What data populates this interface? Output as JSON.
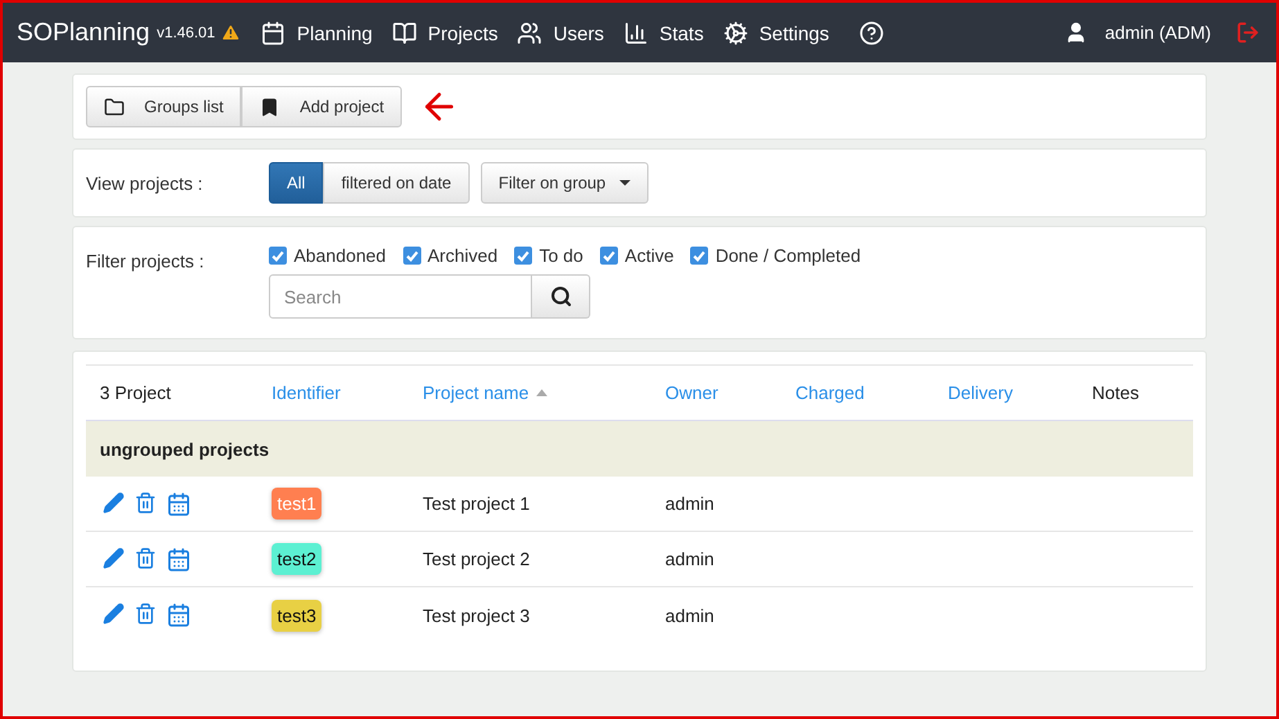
{
  "navbar": {
    "brand": "SOPlanning",
    "version": "v1.46.01",
    "menu": [
      {
        "label": "Planning"
      },
      {
        "label": "Projects"
      },
      {
        "label": "Users"
      },
      {
        "label": "Stats"
      },
      {
        "label": "Settings"
      }
    ],
    "user": "admin (ADM)"
  },
  "toolbar": {
    "buttons": [
      {
        "label": "Groups list"
      },
      {
        "label": "Add project"
      }
    ]
  },
  "view_projects": {
    "label": "View projects :",
    "toggle": [
      {
        "label": "All",
        "selected": true
      },
      {
        "label": "filtered on date",
        "selected": false
      }
    ],
    "dropdown": "Filter on group"
  },
  "filter_projects": {
    "label": "Filter projects :",
    "statuses": [
      {
        "label": "Abandoned",
        "checked": true
      },
      {
        "label": "Archived",
        "checked": true
      },
      {
        "label": "To do",
        "checked": true
      },
      {
        "label": "Active",
        "checked": true
      },
      {
        "label": "Done / Completed",
        "checked": true
      }
    ],
    "search": {
      "placeholder": "Search"
    }
  },
  "table": {
    "columns": [
      {
        "label": "3 Project",
        "link": false,
        "sorted": false
      },
      {
        "label": "Identifier",
        "link": true,
        "sorted": false
      },
      {
        "label": "Project name",
        "link": true,
        "sorted": true
      },
      {
        "label": "Owner",
        "link": true,
        "sorted": false
      },
      {
        "label": "Charged",
        "link": true,
        "sorted": false
      },
      {
        "label": "Delivery",
        "link": true,
        "sorted": false
      },
      {
        "label": "Notes",
        "link": false,
        "sorted": false
      }
    ],
    "group": "ungrouped projects",
    "rows": [
      {
        "identifier": "test1",
        "color": "#ff7f50",
        "name": "Test project 1",
        "owner": "admin"
      },
      {
        "identifier": "test2",
        "color": "#5cf0d2",
        "name": "Test project 2",
        "owner": "admin"
      },
      {
        "identifier": "test3",
        "color": "#e8d044",
        "name": "Test project 3",
        "owner": "admin"
      }
    ]
  }
}
